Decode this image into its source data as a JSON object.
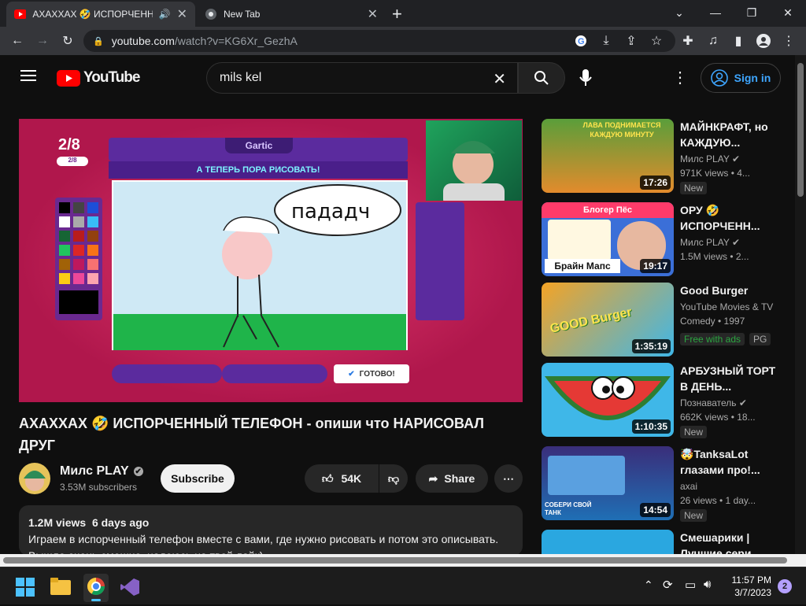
{
  "tabs": [
    {
      "title": "АХАХХАХ 🤣 ИСПОРЧЕННЫ",
      "close": "✕"
    },
    {
      "title": "New Tab",
      "close": "✕"
    }
  ],
  "browser": {
    "new_tab": "+",
    "url_host": "youtube.com",
    "url_rest": "/watch?v=KG6Xr_GezhA"
  },
  "youtube": {
    "logo": "YouTube",
    "search_value": "mils kel",
    "sign_in": "Sign in"
  },
  "video": {
    "title": "АХАХХАХ 🤣 ИСПОРЧЕННЫЙ ТЕЛЕФОН - опиши что НАРИСОВАЛ ДРУГ",
    "channel": "Милс PLAY",
    "subscribers": "3.53M subscribers",
    "subscribe": "Subscribe",
    "likes": "54K",
    "share": "Share",
    "views": "1.2M views",
    "date": "6 days ago",
    "description": "Играем в испорченный телефон вместе с вами, где нужно рисовать и потом это описывать.",
    "description_cut": "Вышло очень смешно, надеюсь на твой лайк)",
    "game": {
      "counter": "2/8",
      "sub_counter": "2/8",
      "brand": "Gartic",
      "prompt": "А ТЕПЕРЬ ПОРА РИСОВАТЬ!",
      "speech": "пададч",
      "done": "ГОТОВО!"
    }
  },
  "recommendations": [
    {
      "title": "МАЙНКРАФТ, но КАЖДУЮ...",
      "channel": "Милс PLAY",
      "verified": "✔",
      "meta": "971K views • 4...",
      "duration": "17:26",
      "badge": "New",
      "thumb_text": "ЛАВА ПОДНИМАЕТСЯ КАЖДУЮ МИНУТУ",
      "thumb_color": "#5a9e3a"
    },
    {
      "title": "ОРУ 🤣 ИСПОРЧЕНН...",
      "channel": "Милс PLAY",
      "verified": "✔",
      "meta": "1.5M views • 2...",
      "duration": "19:17",
      "badge": "",
      "thumb_text": "Блогер Пёс",
      "thumb_text2": "Брайн Мапс",
      "thumb_color": "#3b6fd8"
    },
    {
      "title": "Good Burger",
      "channel": "YouTube Movies & TV",
      "meta": "Comedy • 1997",
      "duration": "1:35:19",
      "badge": "Free with ads",
      "badge2": "PG",
      "thumb_text": "GOOD Burger",
      "thumb_color": "#f4a325"
    },
    {
      "title": "АРБУЗНЫЙ ТОРТ В ДЕНЬ...",
      "channel": "Познаватель",
      "verified": "✔",
      "meta": "662K views • 18...",
      "duration": "1:10:35",
      "badge": "New",
      "thumb_color": "#3fb7e8"
    },
    {
      "title": "🤯TanksaLot глазами про!...",
      "channel": "axai",
      "meta": "26 views • 1 day...",
      "duration": "14:54",
      "badge": "New",
      "thumb_text": "СОБЕРИ СВОЙ ТАНК",
      "thumb_color": "#3a2e7a"
    },
    {
      "title": "Смешарики | Лучшие сери...",
      "channel": "",
      "meta": "",
      "duration": "",
      "badge": "",
      "thumb_color": "#2aa7e0"
    }
  ],
  "taskbar": {
    "time": "11:57 PM",
    "date": "3/7/2023",
    "notifications": "2"
  },
  "colors": {
    "accent": "#ff0000",
    "link": "#3ea6ff",
    "player_bg": "#c2275a"
  }
}
